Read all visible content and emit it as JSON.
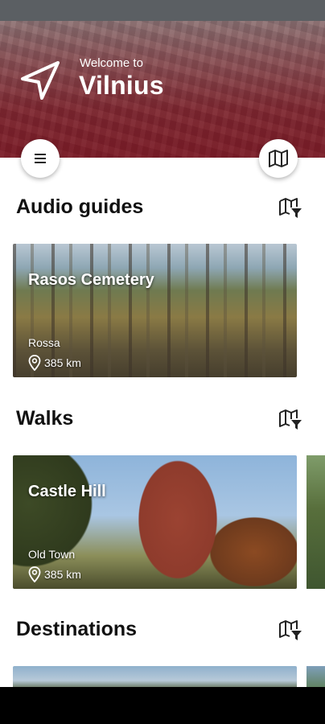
{
  "header": {
    "welcome_text": "Welcome to",
    "city_name": "Vilnius"
  },
  "icons": {
    "navigation": "navigation-arrow-icon",
    "menu": "menu-icon",
    "map": "map-icon",
    "map_filter": "map-filter-icon",
    "location": "location-pin-icon"
  },
  "sections": [
    {
      "title": "Audio guides",
      "cards": [
        {
          "name": "Rasos Cemetery",
          "area": "Rossa",
          "distance": "385 km"
        }
      ]
    },
    {
      "title": "Walks",
      "cards": [
        {
          "name": "Castle Hill",
          "area": "Old Town",
          "distance": "385 km"
        }
      ]
    },
    {
      "title": "Destinations",
      "cards": []
    }
  ],
  "colors": {
    "header_overlay": "#7a1f2a",
    "status_bar": "#5b5f63",
    "nav_bar": "#000000"
  }
}
